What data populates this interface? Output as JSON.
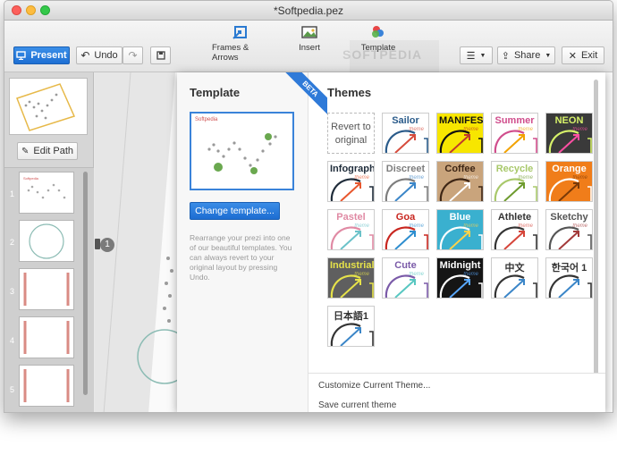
{
  "window": {
    "title": "*Softpedia.pez"
  },
  "toolbar": {
    "present": "Present",
    "undo": "Undo",
    "frames": "Frames & Arrows",
    "insert": "Insert",
    "template": "Template",
    "share": "Share",
    "exit": "Exit"
  },
  "sidebar": {
    "edit_path": "Edit Path",
    "slide_numbers": [
      "1",
      "2",
      "3",
      "4",
      "5"
    ]
  },
  "canvas": {
    "path_badge": "1",
    "watermark": "SOFTPEDIA"
  },
  "template_panel": {
    "title": "Template",
    "badge": "BETA",
    "preview_label": "Softpedia",
    "change_button": "Change template...",
    "hint": "Rearrange your prezi into one of our beautiful templates. You can always revert to your original layout by pressing Undo."
  },
  "themes": {
    "title": "Themes",
    "revert": "Revert to original",
    "theme_word": "theme",
    "items": [
      {
        "name": "Sailor",
        "bg": "#ffffff",
        "fg": "#2a5b8a",
        "accent": "#d64b3c"
      },
      {
        "name": "MANIFESTO",
        "bg": "#f7e600",
        "fg": "#111111",
        "accent": "#c0392b"
      },
      {
        "name": "Summer",
        "bg": "#ffffff",
        "fg": "#d04d8c",
        "accent": "#f2a200"
      },
      {
        "name": "NEON",
        "bg": "#3a3a3a",
        "fg": "#d7f26a",
        "accent": "#ff4fa3"
      },
      {
        "name": "Infographic",
        "bg": "#ffffff",
        "fg": "#1f2c3a",
        "accent": "#e8572e"
      },
      {
        "name": "Discreet",
        "bg": "#ffffff",
        "fg": "#7d7d7d",
        "accent": "#3b86c8"
      },
      {
        "name": "Coffee",
        "bg": "#c9a47c",
        "fg": "#3e2615",
        "accent": "#ffffff"
      },
      {
        "name": "Recycle",
        "bg": "#ffffff",
        "fg": "#a8c86a",
        "accent": "#6e9b2e"
      },
      {
        "name": "Orange",
        "bg": "#f07d1a",
        "fg": "#ffffff",
        "accent": "#7a3a08"
      },
      {
        "name": "Pastel",
        "bg": "#ffffff",
        "fg": "#e08aa4",
        "accent": "#6bc2c9"
      },
      {
        "name": "Goa",
        "bg": "#ffffff",
        "fg": "#c8261f",
        "accent": "#2e8ecf"
      },
      {
        "name": "Blue",
        "bg": "#3ab0cf",
        "fg": "#ffffff",
        "accent": "#ffd24a"
      },
      {
        "name": "Athlete",
        "bg": "#ffffff",
        "fg": "#333333",
        "accent": "#d6453a"
      },
      {
        "name": "Sketchy",
        "bg": "#ffffff",
        "fg": "#555555",
        "accent": "#a33a3a"
      },
      {
        "name": "Industrial",
        "bg": "#5f5f5f",
        "fg": "#e6e24a",
        "accent": "#e6e24a"
      },
      {
        "name": "Cute",
        "bg": "#ffffff",
        "fg": "#7a5aa8",
        "accent": "#58c7c1"
      },
      {
        "name": "Midnight",
        "bg": "#151515",
        "fg": "#ffffff",
        "accent": "#58a8ff"
      },
      {
        "name": "中文",
        "bg": "#ffffff",
        "fg": "#333333",
        "accent": "#3b86c8"
      },
      {
        "name": "한국어 1",
        "bg": "#ffffff",
        "fg": "#333333",
        "accent": "#3b86c8"
      },
      {
        "name": "日本語1",
        "bg": "#ffffff",
        "fg": "#333333",
        "accent": "#3b86c8"
      }
    ]
  },
  "bottom": {
    "customize": "Customize Current Theme...",
    "save": "Save current theme"
  }
}
